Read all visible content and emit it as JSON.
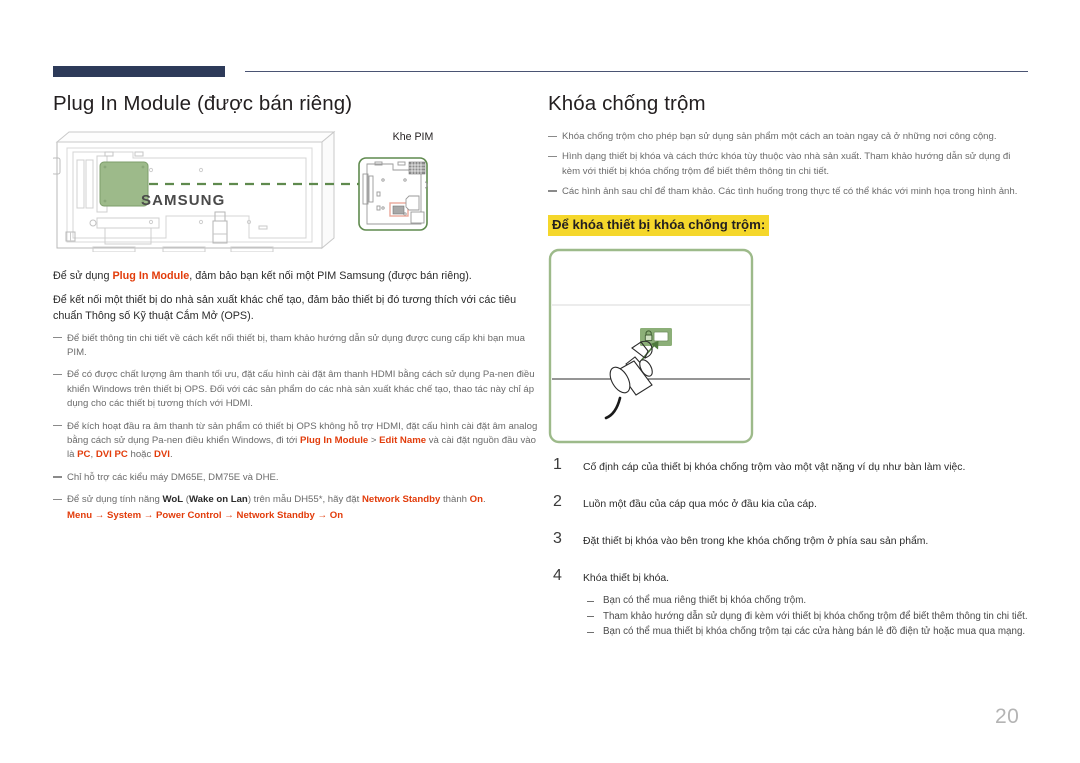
{
  "page": {
    "number": "20",
    "accent_navy": "#2d3a59",
    "accent_red": "#e23c0b",
    "highlight_yellow": "#f5d72b",
    "diagram_green": "#5f8a4e"
  },
  "left": {
    "title": "Plug In Module (được bán riêng)",
    "figure": {
      "brand_label": "SAMSUNG",
      "pim_slot_label": "Khe PIM"
    },
    "paragraphs": [
      {
        "segments": [
          {
            "text": "Để sử dụng ",
            "style": "normal"
          },
          {
            "text": "Plug In Module",
            "style": "red"
          },
          {
            "text": ", đảm bảo bạn kết nối một PIM Samsung (được bán riêng).",
            "style": "normal"
          }
        ]
      },
      {
        "segments": [
          {
            "text": "Để kết nối một thiết bị do nhà sản xuất khác chế tạo, đảm bảo thiết bị đó tương thích với các tiêu chuẩn Thông số Kỹ thuật Cắm Mở (OPS).",
            "style": "normal"
          }
        ]
      }
    ],
    "notes": [
      {
        "segments": [
          {
            "text": "Để biết thông tin chi tiết về cách kết nối thiết bị, tham khảo hướng dẫn sử dụng được cung cấp khi bạn mua PIM.",
            "style": "normal"
          }
        ]
      },
      {
        "segments": [
          {
            "text": "Để có được chất lượng âm thanh tối ưu, đặt cấu hình cài đặt âm thanh HDMI bằng cách sử dụng Pa-nen điều khiển Windows trên thiết bị OPS. Đối với các sản phẩm do các nhà sản xuất khác chế tạo, thao tác này chỉ áp dụng cho các thiết bị tương thích với HDMI.",
            "style": "normal"
          }
        ]
      },
      {
        "segments": [
          {
            "text": "Để kích hoạt đầu ra âm thanh từ sản phẩm có thiết bị OPS không hỗ trợ HDMI, đặt cấu hình cài đặt âm analog bằng cách sử dụng Pa-nen điều khiển Windows, đi tới ",
            "style": "normal"
          },
          {
            "text": "Plug In Module",
            "style": "red"
          },
          {
            "text": " > ",
            "style": "normal"
          },
          {
            "text": "Edit Name",
            "style": "red"
          },
          {
            "text": " và cài đặt nguồn đầu vào là ",
            "style": "normal"
          },
          {
            "text": "PC",
            "style": "red"
          },
          {
            "text": ", ",
            "style": "normal"
          },
          {
            "text": "DVI PC",
            "style": "red"
          },
          {
            "text": " hoặc ",
            "style": "normal"
          },
          {
            "text": "DVI",
            "style": "red"
          },
          {
            "text": ".",
            "style": "normal"
          }
        ]
      },
      {
        "segments": [
          {
            "text": "Chỉ hỗ trợ các kiểu máy DM65E, DM75E và DHE.",
            "style": "normal"
          }
        ]
      },
      {
        "segments": [
          {
            "text": "Để sử dụng tính năng ",
            "style": "normal"
          },
          {
            "text": "WoL",
            "style": "bold"
          },
          {
            "text": " (",
            "style": "normal"
          },
          {
            "text": "Wake on Lan",
            "style": "bold"
          },
          {
            "text": ") trên mẫu DH55*, hãy đặt ",
            "style": "normal"
          },
          {
            "text": "Network Standby",
            "style": "red"
          },
          {
            "text": " thành ",
            "style": "normal"
          },
          {
            "text": "On",
            "style": "red"
          },
          {
            "text": ".",
            "style": "normal"
          },
          {
            "text": "Menu → System → Power Control → Network Standby → On",
            "style": "menu-path"
          }
        ]
      }
    ]
  },
  "right": {
    "title": "Khóa chống trộm",
    "notes": [
      {
        "segments": [
          {
            "text": "Khóa chống trộm cho phép bạn sử dụng sản phẩm một cách an toàn ngay cả ở những nơi công cộng.",
            "style": "normal"
          }
        ]
      },
      {
        "segments": [
          {
            "text": "Hình dạng thiết bị khóa và cách thức khóa tùy thuộc vào nhà sản xuất. Tham khảo hướng dẫn sử dụng đi kèm với thiết bị khóa chống trộm để biết thêm thông tin chi tiết.",
            "style": "normal"
          }
        ]
      },
      {
        "segments": [
          {
            "text": "Các hình ảnh sau chỉ để tham khảo. Các tình huống trong thực tế có thể khác với minh họa trong hình ảnh.",
            "style": "normal"
          }
        ]
      }
    ],
    "highlight_heading": "Để khóa thiết bị khóa chống trộm:",
    "steps": [
      {
        "num": "1",
        "text": "Cố định cáp của thiết bị khóa chống trộm vào một vật nặng ví dụ như bàn làm việc."
      },
      {
        "num": "2",
        "text": "Luồn một đầu của cáp qua móc ở đầu kia của cáp."
      },
      {
        "num": "3",
        "text": "Đặt thiết bị khóa vào bên trong khe khóa chống trộm ở phía sau sản phẩm."
      },
      {
        "num": "4",
        "text": "Khóa thiết bị khóa."
      }
    ],
    "substeps": [
      "Bạn có thể mua riêng thiết bị khóa chống trộm.",
      "Tham khảo hướng dẫn sử dụng đi kèm với thiết bị khóa chống trộm để biết thêm thông tin chi tiết.",
      "Bạn có thể mua thiết bị khóa chống trộm tại các cửa hàng bán lẻ đồ điện tử hoặc mua qua mạng."
    ]
  }
}
